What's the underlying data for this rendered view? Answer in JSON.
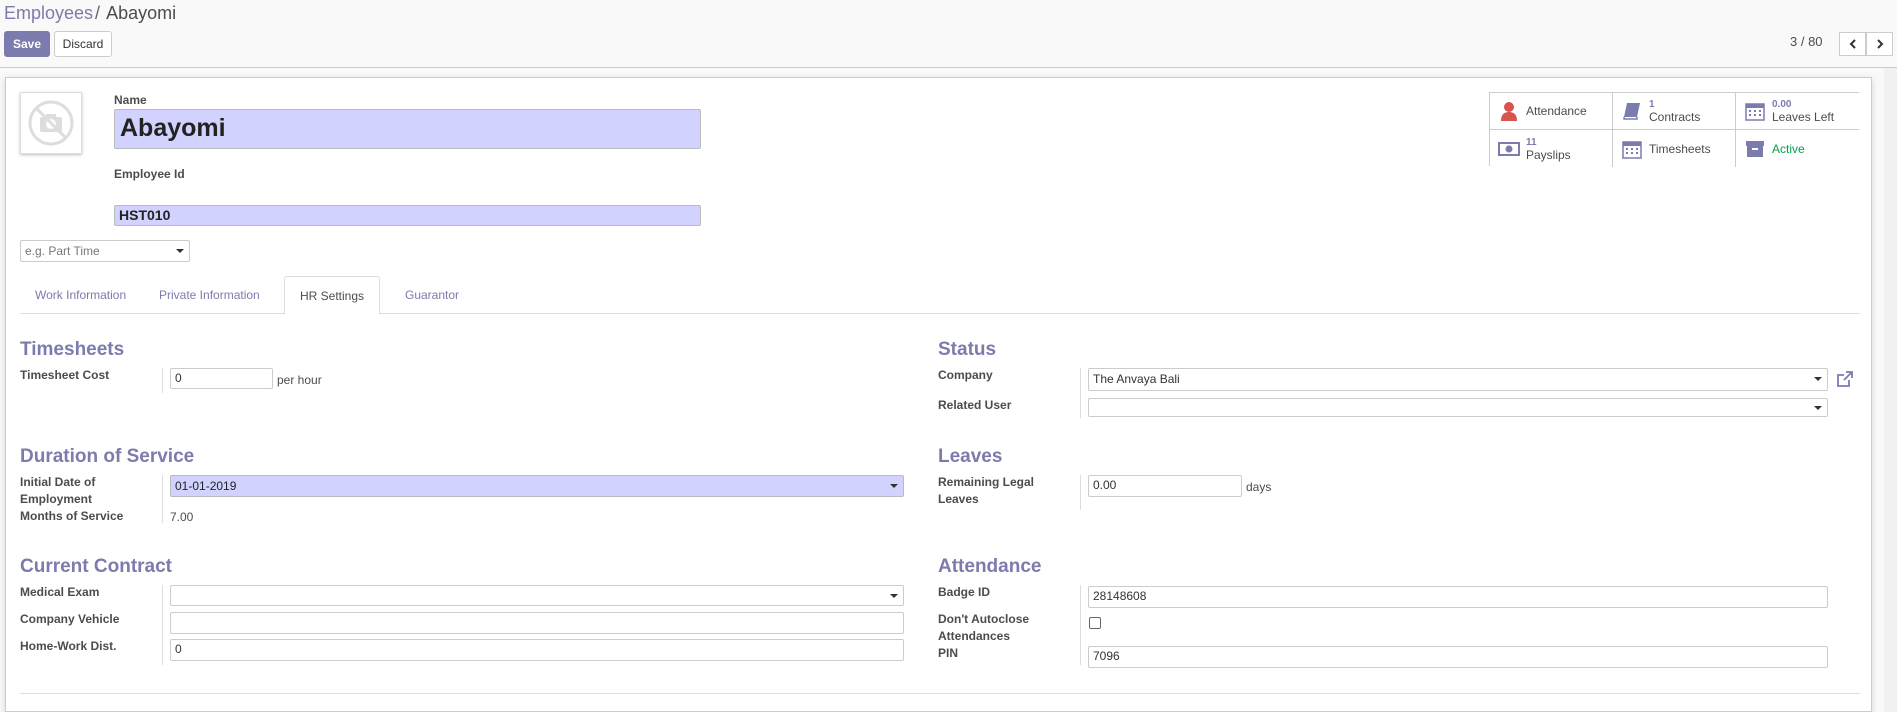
{
  "breadcrumb": {
    "parent": "Employees",
    "separator": "/",
    "current": "Abayomi"
  },
  "toolbar": {
    "save_label": "Save",
    "discard_label": "Discard"
  },
  "pager": {
    "value": "3 / 80",
    "prev_icon": "chevron-left-icon",
    "next_icon": "chevron-right-icon"
  },
  "header": {
    "name_label": "Name",
    "name_value": "Abayomi",
    "employee_id_label": "Employee Id",
    "employee_id_value": "HST010",
    "category_placeholder": "e.g. Part Time"
  },
  "smart_buttons": {
    "attendance": {
      "label": "Attendance",
      "icon": "user-icon"
    },
    "contracts": {
      "count": "1",
      "label": "Contracts",
      "icon": "book-icon"
    },
    "leaves": {
      "count": "0.00",
      "label": "Leaves Left",
      "icon": "calendar-icon"
    },
    "payslips": {
      "count": "11",
      "label": "Payslips",
      "icon": "money-icon"
    },
    "timesheets": {
      "label": "Timesheets",
      "icon": "calendar-icon"
    },
    "active": {
      "label": "Active",
      "icon": "archive-icon",
      "color": "#00A04A"
    }
  },
  "tabs": [
    "Work Information",
    "Private Information",
    "HR Settings",
    "Guarantor"
  ],
  "active_tab": "HR Settings",
  "timesheets": {
    "title": "Timesheets",
    "cost_label": "Timesheet Cost",
    "cost_value": "0",
    "cost_unit": "per hour"
  },
  "status": {
    "title": "Status",
    "company_label": "Company",
    "company_value": "The Anvaya Bali",
    "related_user_label": "Related User",
    "related_user_value": ""
  },
  "duration": {
    "title": "Duration of Service",
    "initial_date_label_1": "Initial Date of",
    "initial_date_label_2": "Employment",
    "initial_date_value": "01-01-2019",
    "months_label": "Months of Service",
    "months_value": "7.00"
  },
  "leaves": {
    "title": "Leaves",
    "remaining_label_1": "Remaining Legal",
    "remaining_label_2": "Leaves",
    "remaining_value": "0.00",
    "remaining_unit": "days"
  },
  "contract": {
    "title": "Current Contract",
    "medical_label": "Medical Exam",
    "medical_value": "",
    "vehicle_label": "Company Vehicle",
    "vehicle_value": "",
    "distance_label": "Home-Work Dist.",
    "distance_value": "0"
  },
  "attendance": {
    "title": "Attendance",
    "badge_label": "Badge ID",
    "badge_value": "28148608",
    "autoclose_label_1": "Don't Autoclose",
    "autoclose_label_2": "Attendances",
    "autoclose_checked": false,
    "pin_label": "PIN",
    "pin_value": "7096"
  },
  "colors": {
    "accent": "#7C7BAD",
    "required_field": "#D2D2FF",
    "active_green": "#00A04A"
  }
}
